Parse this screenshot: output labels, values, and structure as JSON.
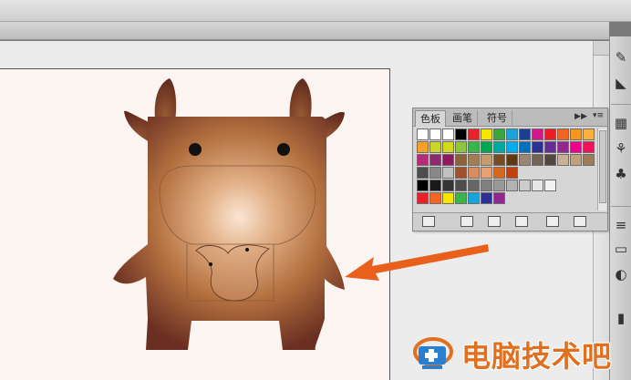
{
  "swatch_panel": {
    "tabs": [
      {
        "label": "色板",
        "active": true
      },
      {
        "label": "画笔",
        "active": false
      },
      {
        "label": "符号",
        "active": false
      }
    ],
    "rows": [
      [
        "#ffffff",
        "#ffffff",
        "#ffffff",
        "#000000",
        "#e8222a",
        "#f5e600",
        "#3aa53a",
        "#17a4d8",
        "#1a3f96",
        "#d3168a",
        "#ec1c24",
        "#f26522",
        "#f7941d",
        "#fbaf3f"
      ],
      [
        "#f6a02b",
        "#c9d52e",
        "#d3d91e",
        "#8dc63f",
        "#39b54a",
        "#00a651",
        "#00a99d",
        "#00aeef",
        "#0072bc",
        "#2e3192",
        "#662d91",
        "#92278f",
        "#ec008c",
        "#ed145b"
      ],
      [
        "#b72a7a",
        "#8c2a6f",
        "#8e1a5e",
        "#8c6239",
        "#a67c52",
        "#c69c6d",
        "#754c24",
        "#603913",
        "#998675",
        "#736357",
        "#534741",
        "#c7b299",
        "#bfa27c",
        "#9e7b59"
      ],
      [
        "#4d4d4d",
        "#888888",
        "#c1c1c1",
        "#a0522d",
        "#d98c5f",
        "#e8a070",
        "#d2691e",
        "#c04010"
      ],
      [
        "#000000",
        "#1a1a1a",
        "#333333",
        "#4d4d4d",
        "#666666",
        "#808080",
        "#999999",
        "#b3b3b3",
        "#cccccc",
        "#e6e6e6",
        "#f2f2f2"
      ],
      [
        "#e8222a",
        "#f26522",
        "#f5e600",
        "#39b54a",
        "#17a4d8",
        "#2e3192",
        "#92278f"
      ]
    ]
  },
  "watermark": {
    "text": "电脑技术吧"
  },
  "colors": {
    "arrow": "#e8601c",
    "cow_body_light": "#f7dcc4",
    "cow_body_dark": "#6e3424",
    "watermark": "#e07020"
  }
}
